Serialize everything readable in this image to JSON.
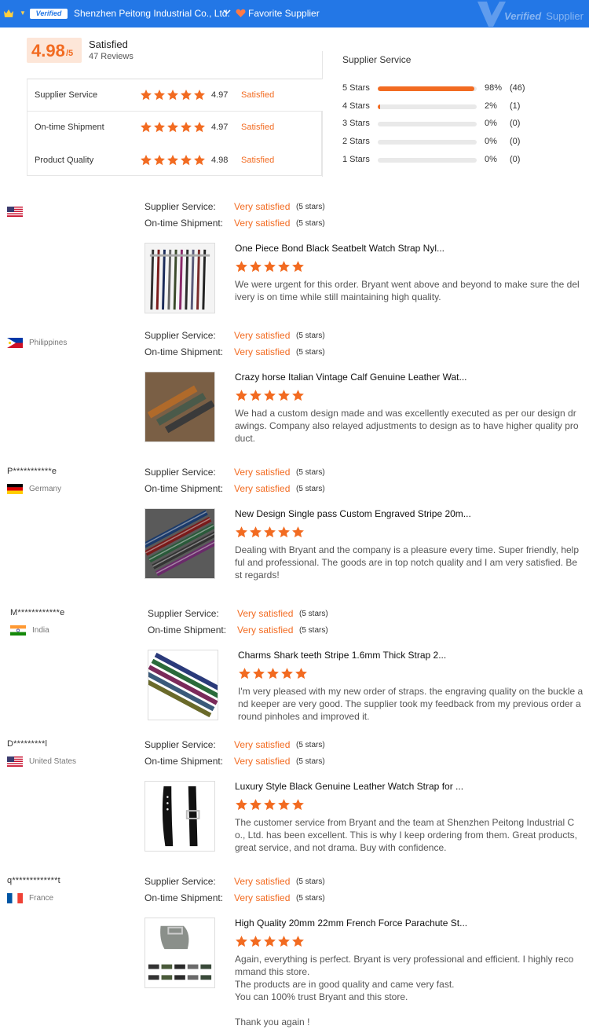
{
  "header": {
    "verified_badge": "Verified",
    "supplier_name": "Shenzhen Peitong Industrial Co., Ltd.",
    "favorite_label": "Favorite Supplier",
    "watermark": {
      "word": "Verified",
      "suffix": "Supplier"
    },
    "brand_color": "#2377e6",
    "icons": [
      "crown-icon",
      "chevron-down-icon",
      "heart-icon",
      "verified-v-watermark-icon"
    ]
  },
  "summary": {
    "score": "4.98",
    "score_suffix": "/5",
    "label": "Satisfied",
    "reviews_count": "47 Reviews",
    "accent_color": "#f26b21",
    "metrics": [
      {
        "label": "Supplier Service",
        "stars": 5,
        "value": "4.97",
        "status": "Satisfied"
      },
      {
        "label": "On-time Shipment",
        "stars": 5,
        "value": "4.97",
        "status": "Satisfied"
      },
      {
        "label": "Product Quality",
        "stars": 5,
        "value": "4.98",
        "status": "Satisfied"
      }
    ]
  },
  "distribution": {
    "title": "Supplier Service",
    "rows": [
      {
        "label": "5 Stars",
        "fraction": 0.98,
        "percent": "98%",
        "count": "(46)"
      },
      {
        "label": "4 Stars",
        "fraction": 0.02,
        "percent": "2%",
        "count": "(1)"
      },
      {
        "label": "3 Stars",
        "fraction": 0,
        "percent": "0%",
        "count": "(0)"
      },
      {
        "label": "2 Stars",
        "fraction": 0,
        "percent": "0%",
        "count": "(0)"
      },
      {
        "label": "1 Stars",
        "fraction": 0,
        "percent": "0%",
        "count": "(0)"
      }
    ]
  },
  "review_labels": {
    "supplier_service": "Supplier Service:",
    "ontime_shipment": "On-time Shipment:",
    "very_satisfied": "Very satisfied",
    "five_stars": "(5 stars)"
  },
  "reviews": [
    {
      "user": "",
      "country": "",
      "flag": "us",
      "product_title": "One Piece Bond Black Seatbelt Watch Strap Nyl...",
      "stars": 5,
      "text": "We were urgent for this order. Bryant went above and beyond to make sure the delivery is on time while still maintaining high quality."
    },
    {
      "user": "",
      "country": "Philippines",
      "flag": "ph",
      "product_title": "Crazy horse Italian Vintage Calf Genuine Leather Wat...",
      "stars": 5,
      "text": "We had a custom design made and was excellently executed as per our design drawings. Company also relayed adjustments to design as to have higher quality product."
    },
    {
      "user": "P***********e",
      "country": "Germany",
      "flag": "de",
      "product_title": "New Design Single pass Custom Engraved Stripe 20m...",
      "stars": 5,
      "text": "Dealing with Bryant and the company is a pleasure every time. Super friendly, helpful and professional. The goods are in top notch quality and I am very satisfied. Best regards!"
    },
    {
      "user": "M************e",
      "country": "India",
      "flag": "in",
      "product_title": "Charms Shark teeth Stripe 1.6mm Thick Strap 2...",
      "stars": 5,
      "text": "I'm very pleased with my new order of straps. the engraving quality on the buckle and keeper are very good. The supplier took my feedback from my previous order around pinholes and improved it."
    },
    {
      "user": "D*********l",
      "country": "United States",
      "flag": "us",
      "product_title": "Luxury Style Black Genuine Leather Watch Strap for ...",
      "stars": 5,
      "text": "The customer service from Bryant and the team at Shenzhen Peitong Industrial Co., Ltd. has been excellent.  This is why I keep ordering from them.  Great products, great service, and not drama.  Buy with confidence."
    },
    {
      "user": "q*************t",
      "country": "France",
      "flag": "fr",
      "product_title": "High Quality 20mm 22mm French Force Parachute St...",
      "stars": 5,
      "text": "Again, everything is perfect. Bryant is very professional and efficient. I highly recommand this store.\nThe products are in good quality and came very fast.\nYou can 100% trust Bryant and this store.\n\nThank you again !"
    }
  ]
}
